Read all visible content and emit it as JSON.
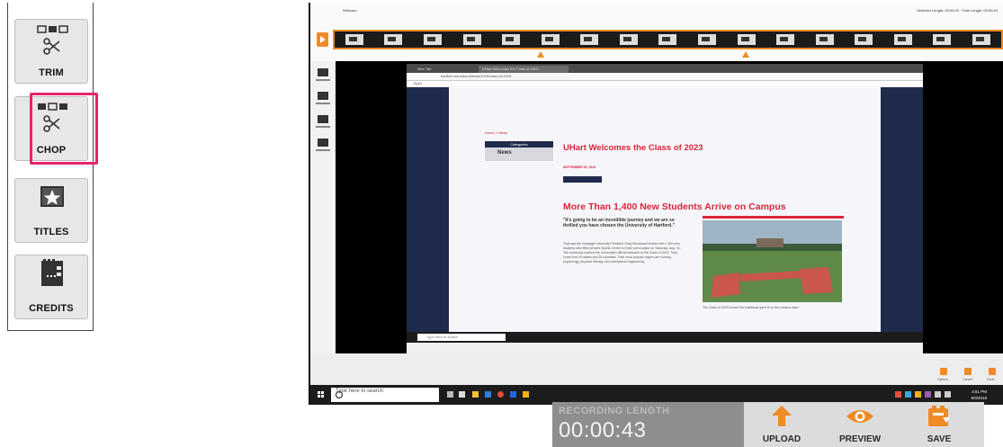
{
  "tools": {
    "trim": "TRIM",
    "chop": "CHOP",
    "titles": "TITLES",
    "credits": "CREDITS"
  },
  "recorder": {
    "timeline": {
      "caption_left": "Webcam",
      "caption_right": "Selected Length: 00:00:00 · Total Length: 00:00:43"
    },
    "browser": {
      "tabs": [
        "New Tab",
        "UHart Welcomes the Class of 2023"
      ],
      "url": "hartford.edu/about/news/2019/class-of-2023",
      "bookmarks": "Apps"
    },
    "site": {
      "breadcrumb": "Home » News",
      "nav_header": "Categories",
      "nav_item": "News",
      "headline": "UHart Welcomes the Class of 2023",
      "date": "SEPTEMBER 01, 2019",
      "subheadline": "More Than 1,400 New Students Arrive on Campus",
      "quote": "\"It's going to be an incredible journey and we are so thrilled you have chosen the University of Hartford.\"",
      "body": "That was the message University President Greg Woodward shared with 1,400 new students who filled UHart's Sports Center for their convocation on Saturday, Aug. 31. The ceremony marked the University's official welcome to the Class of 2023. They come from 29 states and 26 countries. Their most popular majors are nursing, psychology, physical therapy, and mechanical engineering.",
      "photo_caption": "The Class of 2023 formed the traditional giant H on the campus lawn."
    },
    "inner_taskbar": {
      "search": "Type here to search"
    },
    "host_taskbar": {
      "search": "Type here to search",
      "time": "4:51 PM",
      "date": "9/3/2019"
    },
    "strip_buttons": [
      "Options",
      "Cancel",
      "Done"
    ]
  },
  "recording": {
    "label": "RECORDING LENGTH",
    "time": "00:00:43"
  },
  "actions": {
    "upload": "UPLOAD",
    "preview": "PREVIEW",
    "save": "SAVE"
  },
  "colors": {
    "highlight": "#e6236e",
    "accent_orange": "#f08a24",
    "brand_red": "#d8263a",
    "brand_navy": "#1e2b4d"
  }
}
